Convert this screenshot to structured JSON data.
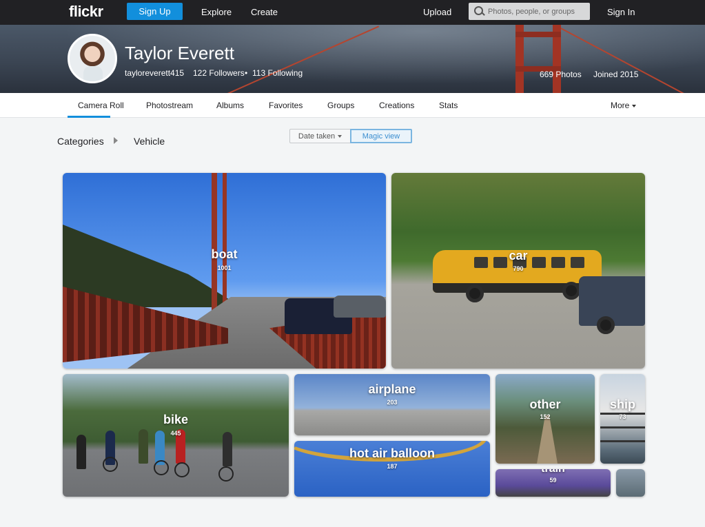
{
  "topnav": {
    "logo": "flickr",
    "signup": "Sign Up",
    "explore": "Explore",
    "create": "Create",
    "upload": "Upload",
    "search_placeholder": "Photos, people, or groups",
    "signin": "Sign In"
  },
  "profile": {
    "name": "Taylor Everett",
    "username": "tayloreverett415",
    "followers": "122 Followers",
    "following": "113 Following",
    "photos": "669 Photos",
    "joined": "Joined 2015"
  },
  "tabs": [
    "Camera Roll",
    "Photostream",
    "Albums",
    "Favorites",
    "Groups",
    "Creations",
    "Stats"
  ],
  "more": "More",
  "filters": {
    "breadcrumb": [
      "Categories",
      "Vehicle"
    ],
    "date_taken": "Date taken",
    "magic_view": "Magic view"
  },
  "tiles": [
    {
      "label": "boat",
      "count": "1001"
    },
    {
      "label": "car",
      "count": "790"
    },
    {
      "label": "bike",
      "count": "445"
    },
    {
      "label": "airplane",
      "count": "203"
    },
    {
      "label": "hot air balloon",
      "count": "187"
    },
    {
      "label": "other",
      "count": "152"
    },
    {
      "label": "ship",
      "count": "73"
    },
    {
      "label": "train",
      "count": "59"
    }
  ],
  "colors": {
    "topbar": "#212124",
    "accent": "#128fdc"
  }
}
